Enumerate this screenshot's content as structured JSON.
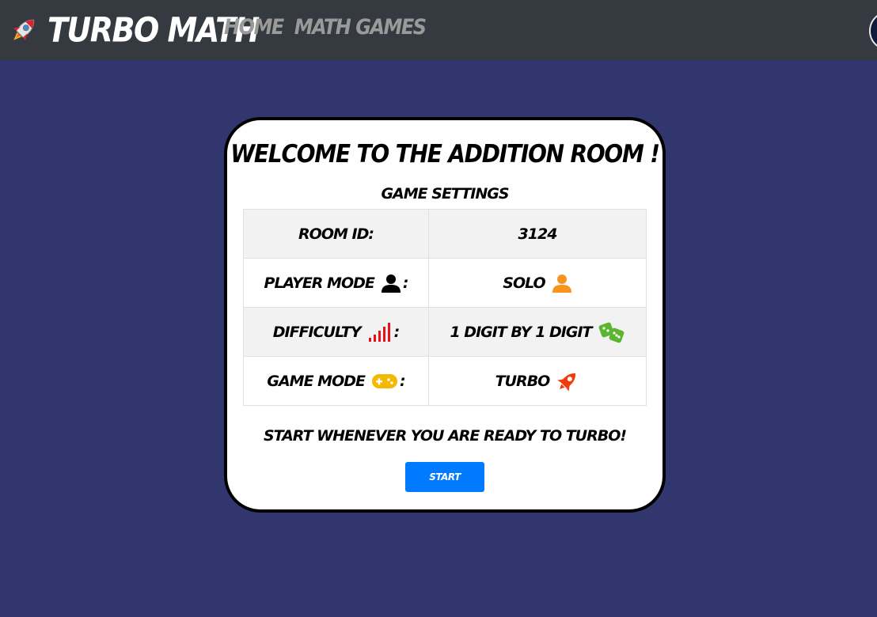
{
  "navbar": {
    "brand_icon": "rocket-icon",
    "brand_name": "Turbo Math",
    "links": [
      {
        "label": "Home"
      },
      {
        "label": "Math Games"
      }
    ],
    "avatar_icon": "avatar"
  },
  "card": {
    "title": "Welcome to the addition room !",
    "settings_title": "Game Settings",
    "rows": [
      {
        "label": "Room ID:",
        "value": "3124"
      },
      {
        "label": "Player Mode",
        "label_icon": "user-icon",
        "value": "Solo",
        "value_icon": "user-icon"
      },
      {
        "label": "Difficulty",
        "label_icon": "signal-bars-icon",
        "value": "1 digit by 1 digit",
        "value_icon": "dice-icon"
      },
      {
        "label": "Game Mode",
        "label_icon": "gamepad-icon",
        "value": "Turbo",
        "value_icon": "rocket-icon"
      }
    ],
    "colon": ":",
    "ready_text": "Start whenever you are ready to Turbo!",
    "start_label": "Start"
  },
  "colors": {
    "background": "#32366e",
    "navbar": "#343a40",
    "nav_link": "#9a9a9a",
    "start_button": "#007bff",
    "player_value_icon": "#f7941d",
    "difficulty_icon": "#e8111a",
    "dice_icon": "#5cb531",
    "gamepad_icon": "#f5b800",
    "turbo_rocket_icon": "#f23a0c"
  }
}
